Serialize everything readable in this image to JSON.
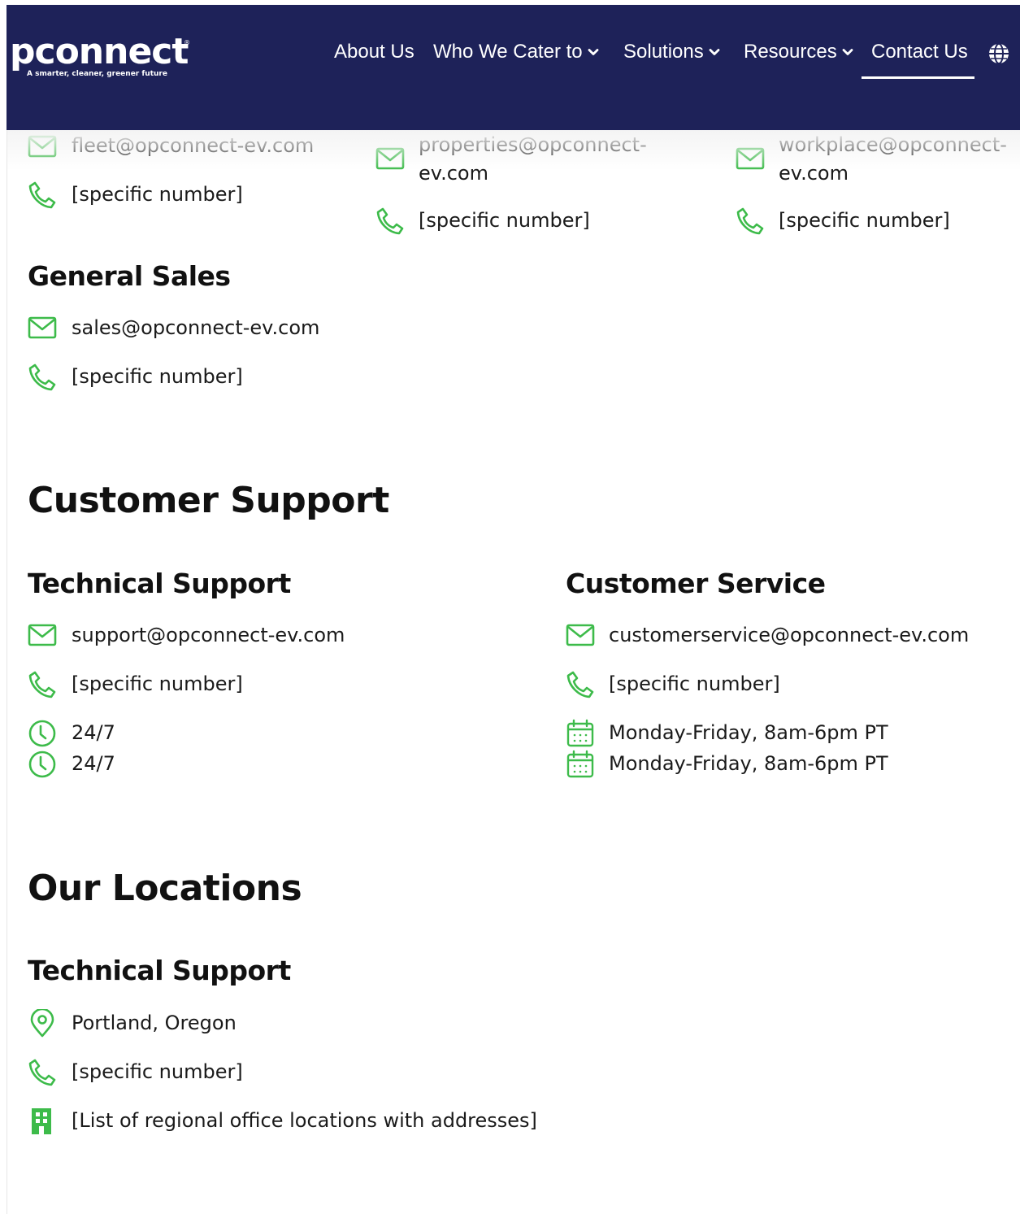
{
  "header": {
    "logo_text": "pconnect",
    "logo_reg": "®",
    "logo_tagline": "A smarter, cleaner, greener future",
    "nav": [
      {
        "label": "About Us"
      },
      {
        "label": "Who We Cater to"
      },
      {
        "label": "Solutions"
      },
      {
        "label": "Resources"
      },
      {
        "label": "Contact Us"
      }
    ]
  },
  "top_contacts": {
    "fleet": {
      "email": "fleet@opconnect-ev.com",
      "phone": "[specific number]"
    },
    "properties": {
      "email": "properties@opconnect-ev.com",
      "phone": "[specific number]"
    },
    "workplace": {
      "email": "workplace@opconnect-ev.com",
      "phone": "[specific number]"
    }
  },
  "general_sales": {
    "title": "General Sales",
    "email": "sales@opconnect-ev.com",
    "phone": "[specific number]"
  },
  "customer_support": {
    "title": "Customer Support",
    "technical": {
      "title": "Technical Support",
      "email": "support@opconnect-ev.com",
      "phone": "[specific number]",
      "hours": [
        "24/7",
        "24/7"
      ]
    },
    "service": {
      "title": "Customer Service",
      "email": "customerservice@opconnect-ev.com",
      "phone": "[specific number]",
      "hours": [
        "Monday-Friday, 8am-6pm PT",
        "Monday-Friday, 8am-6pm PT"
      ]
    }
  },
  "locations": {
    "title": "Our Locations",
    "subtitle": "Technical Support",
    "city": "Portland, Oregon",
    "phone": "[specific number]",
    "offices": "[List of regional office locations with addresses]"
  },
  "colors": {
    "header_bg": "#1e2259",
    "accent_green": "#3dbb4a"
  }
}
